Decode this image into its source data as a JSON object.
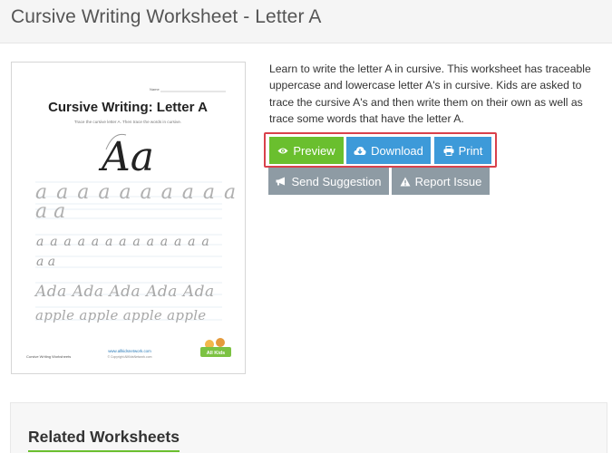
{
  "page": {
    "title": "Cursive Writing Worksheet - Letter A",
    "description": "Learn to write the letter A in cursive. This worksheet has traceable uppercase and lowercase letter A's in cursive. Kids are asked to trace the cursive A's and then write them on their own as well as trace some words that have the letter A."
  },
  "actions": {
    "preview": {
      "label": "Preview",
      "icon": "eye-icon",
      "color": "#6abf2e"
    },
    "download": {
      "label": "Download",
      "icon": "cloud-download-icon",
      "color": "#3d9ad9"
    },
    "print": {
      "label": "Print",
      "icon": "printer-icon",
      "color": "#3d9ad9"
    },
    "send_suggestion": {
      "label": "Send Suggestion",
      "icon": "megaphone-icon",
      "color": "#8e9ba4"
    },
    "report_issue": {
      "label": "Report Issue",
      "icon": "warning-icon",
      "color": "#8e9ba4"
    },
    "highlight_color": "#d9414b"
  },
  "worksheet": {
    "name_label": "Name",
    "heading": "Cursive Writing: Letter A",
    "instruction": "Trace the cursive letter A. Then trace the words in cursive.",
    "big_letters": "Aa",
    "row_upper": "a a a a a a a a a a",
    "row_upper2": "a a",
    "row_lower": "a a a a a a a a a a a a a",
    "row_lower2": "a a",
    "row_ada": "Ada Ada Ada Ada Ada",
    "row_apple": "apple apple apple apple",
    "footer_left": "Cursive Writing Worksheets",
    "footer_url": "www.allkidsnetwork.com",
    "footer_copy": "© Copyright AllKidsNetwork.com",
    "logo_text": "All Kids"
  },
  "related": {
    "title": "Related Worksheets"
  }
}
